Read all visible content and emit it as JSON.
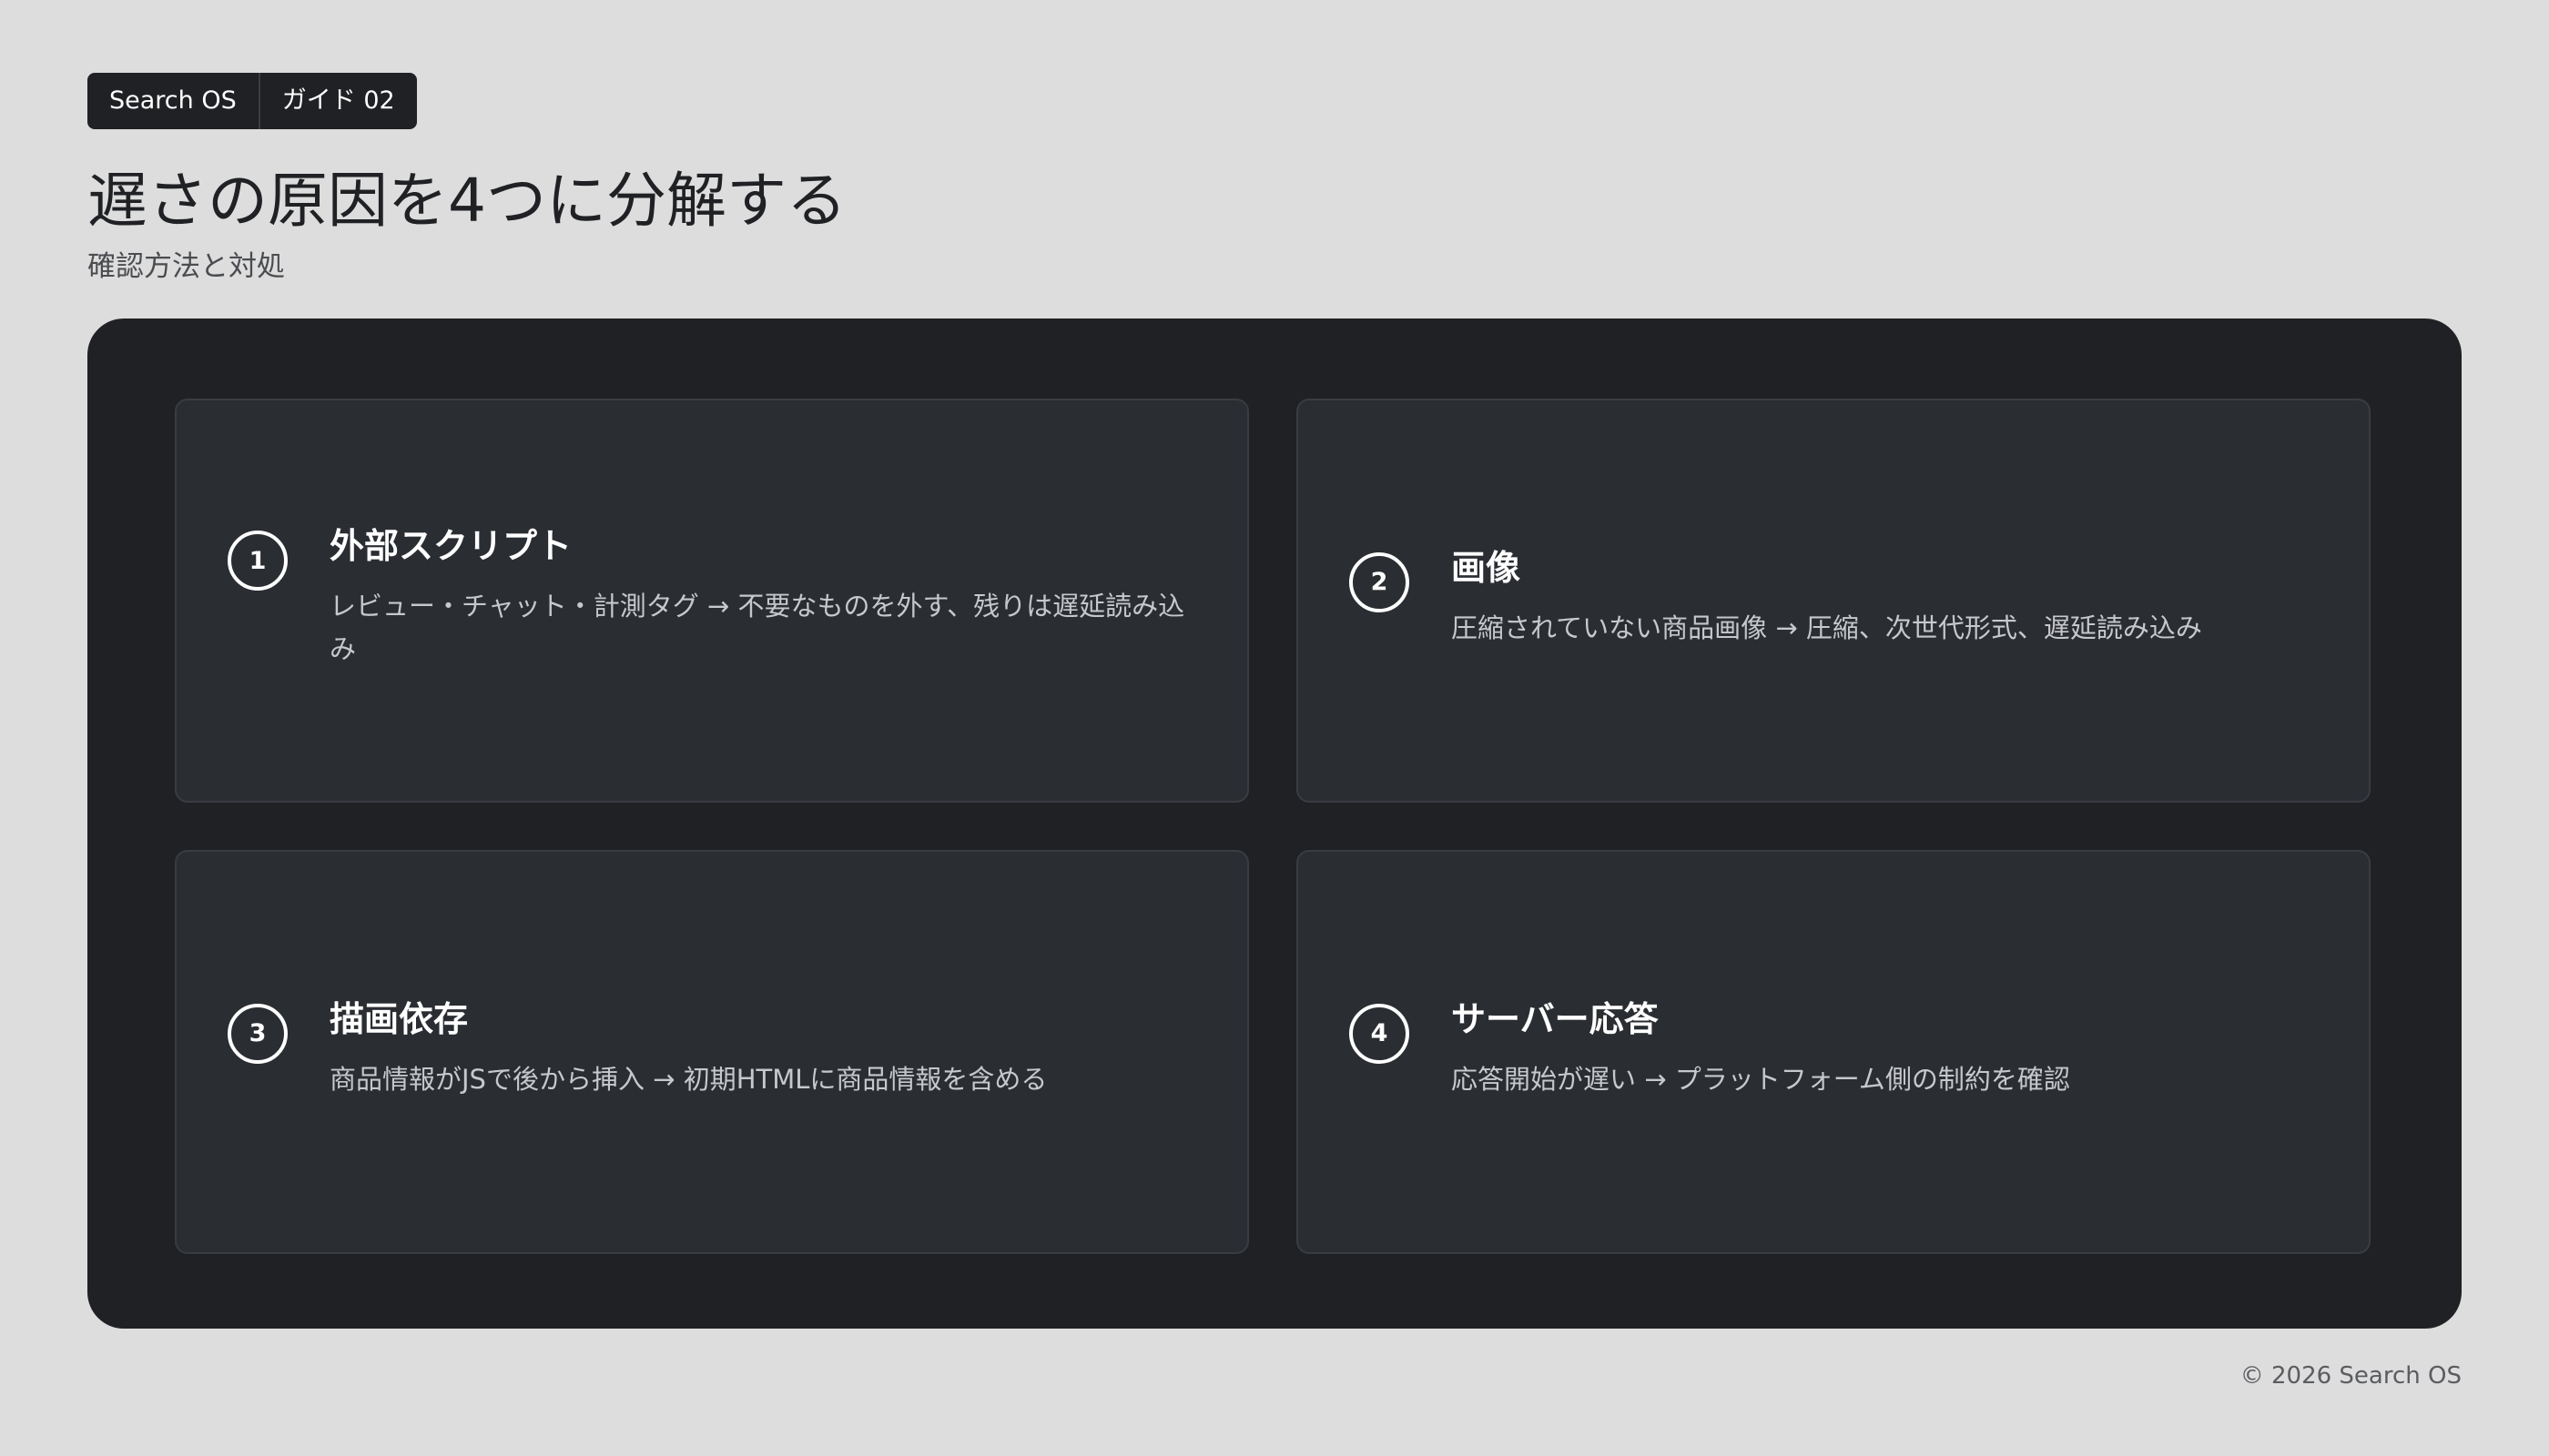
{
  "header": {
    "tags": [
      "Search OS",
      "ガイド 02"
    ],
    "title": "遅さの原因を4つに分解する",
    "subtitle": "確認方法と対処"
  },
  "cards": [
    {
      "number": "1",
      "title": "外部スクリプト",
      "description": "レビュー・チャット・計測タグ → 不要なものを外す、残りは遅延読み込み"
    },
    {
      "number": "2",
      "title": "画像",
      "description": "圧縮されていない商品画像 → 圧縮、次世代形式、遅延読み込み"
    },
    {
      "number": "3",
      "title": "描画依存",
      "description": "商品情報がJSで後から挿入 → 初期HTMLに商品情報を含める"
    },
    {
      "number": "4",
      "title": "サーバー応答",
      "description": "応答開始が遅い → プラットフォーム側の制約を確認"
    }
  ],
  "footer": {
    "copyright": "© 2026 Search OS"
  },
  "colors": {
    "background": "#dddddd",
    "panel": "#202124",
    "card": "#2a2d32",
    "text_light": "#ffffff"
  }
}
